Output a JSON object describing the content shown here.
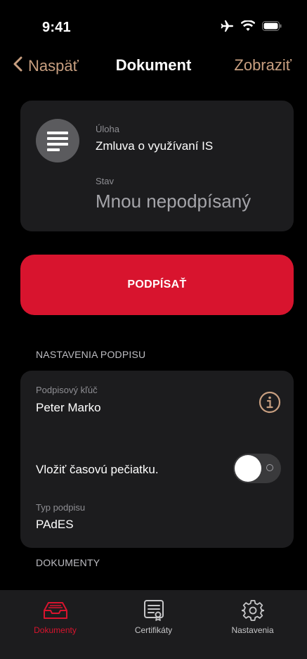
{
  "status_bar": {
    "time": "9:41"
  },
  "nav": {
    "back_label": "Naspäť",
    "title": "Dokument",
    "action_label": "Zobraziť"
  },
  "document": {
    "task_label": "Úloha",
    "task_value": "Zmluva o využívaní IS",
    "state_label": "Stav",
    "state_value": "Mnou nepodpísaný"
  },
  "sign_button": {
    "label": "PODPÍSAŤ"
  },
  "signature_settings": {
    "header": "NASTAVENIA PODPISU",
    "key_label": "Podpisový kľúč",
    "key_value": "Peter Marko",
    "timestamp_label": "Vložiť časovú pečiatku.",
    "timestamp_enabled": false,
    "type_label": "Typ podpisu",
    "type_value": "PAdES"
  },
  "documents_section": {
    "header": "DOKUMENTY"
  },
  "tabbar": {
    "items": [
      {
        "label": "Dokumenty",
        "icon": "inbox-tray-icon",
        "active": true
      },
      {
        "label": "Certifikáty",
        "icon": "certificate-icon",
        "active": false
      },
      {
        "label": "Nastavenia",
        "icon": "gear-icon",
        "active": false
      }
    ]
  },
  "colors": {
    "accent": "#c89f80",
    "primary": "#d8142e",
    "card": "#1c1c1e",
    "background": "#000000"
  }
}
